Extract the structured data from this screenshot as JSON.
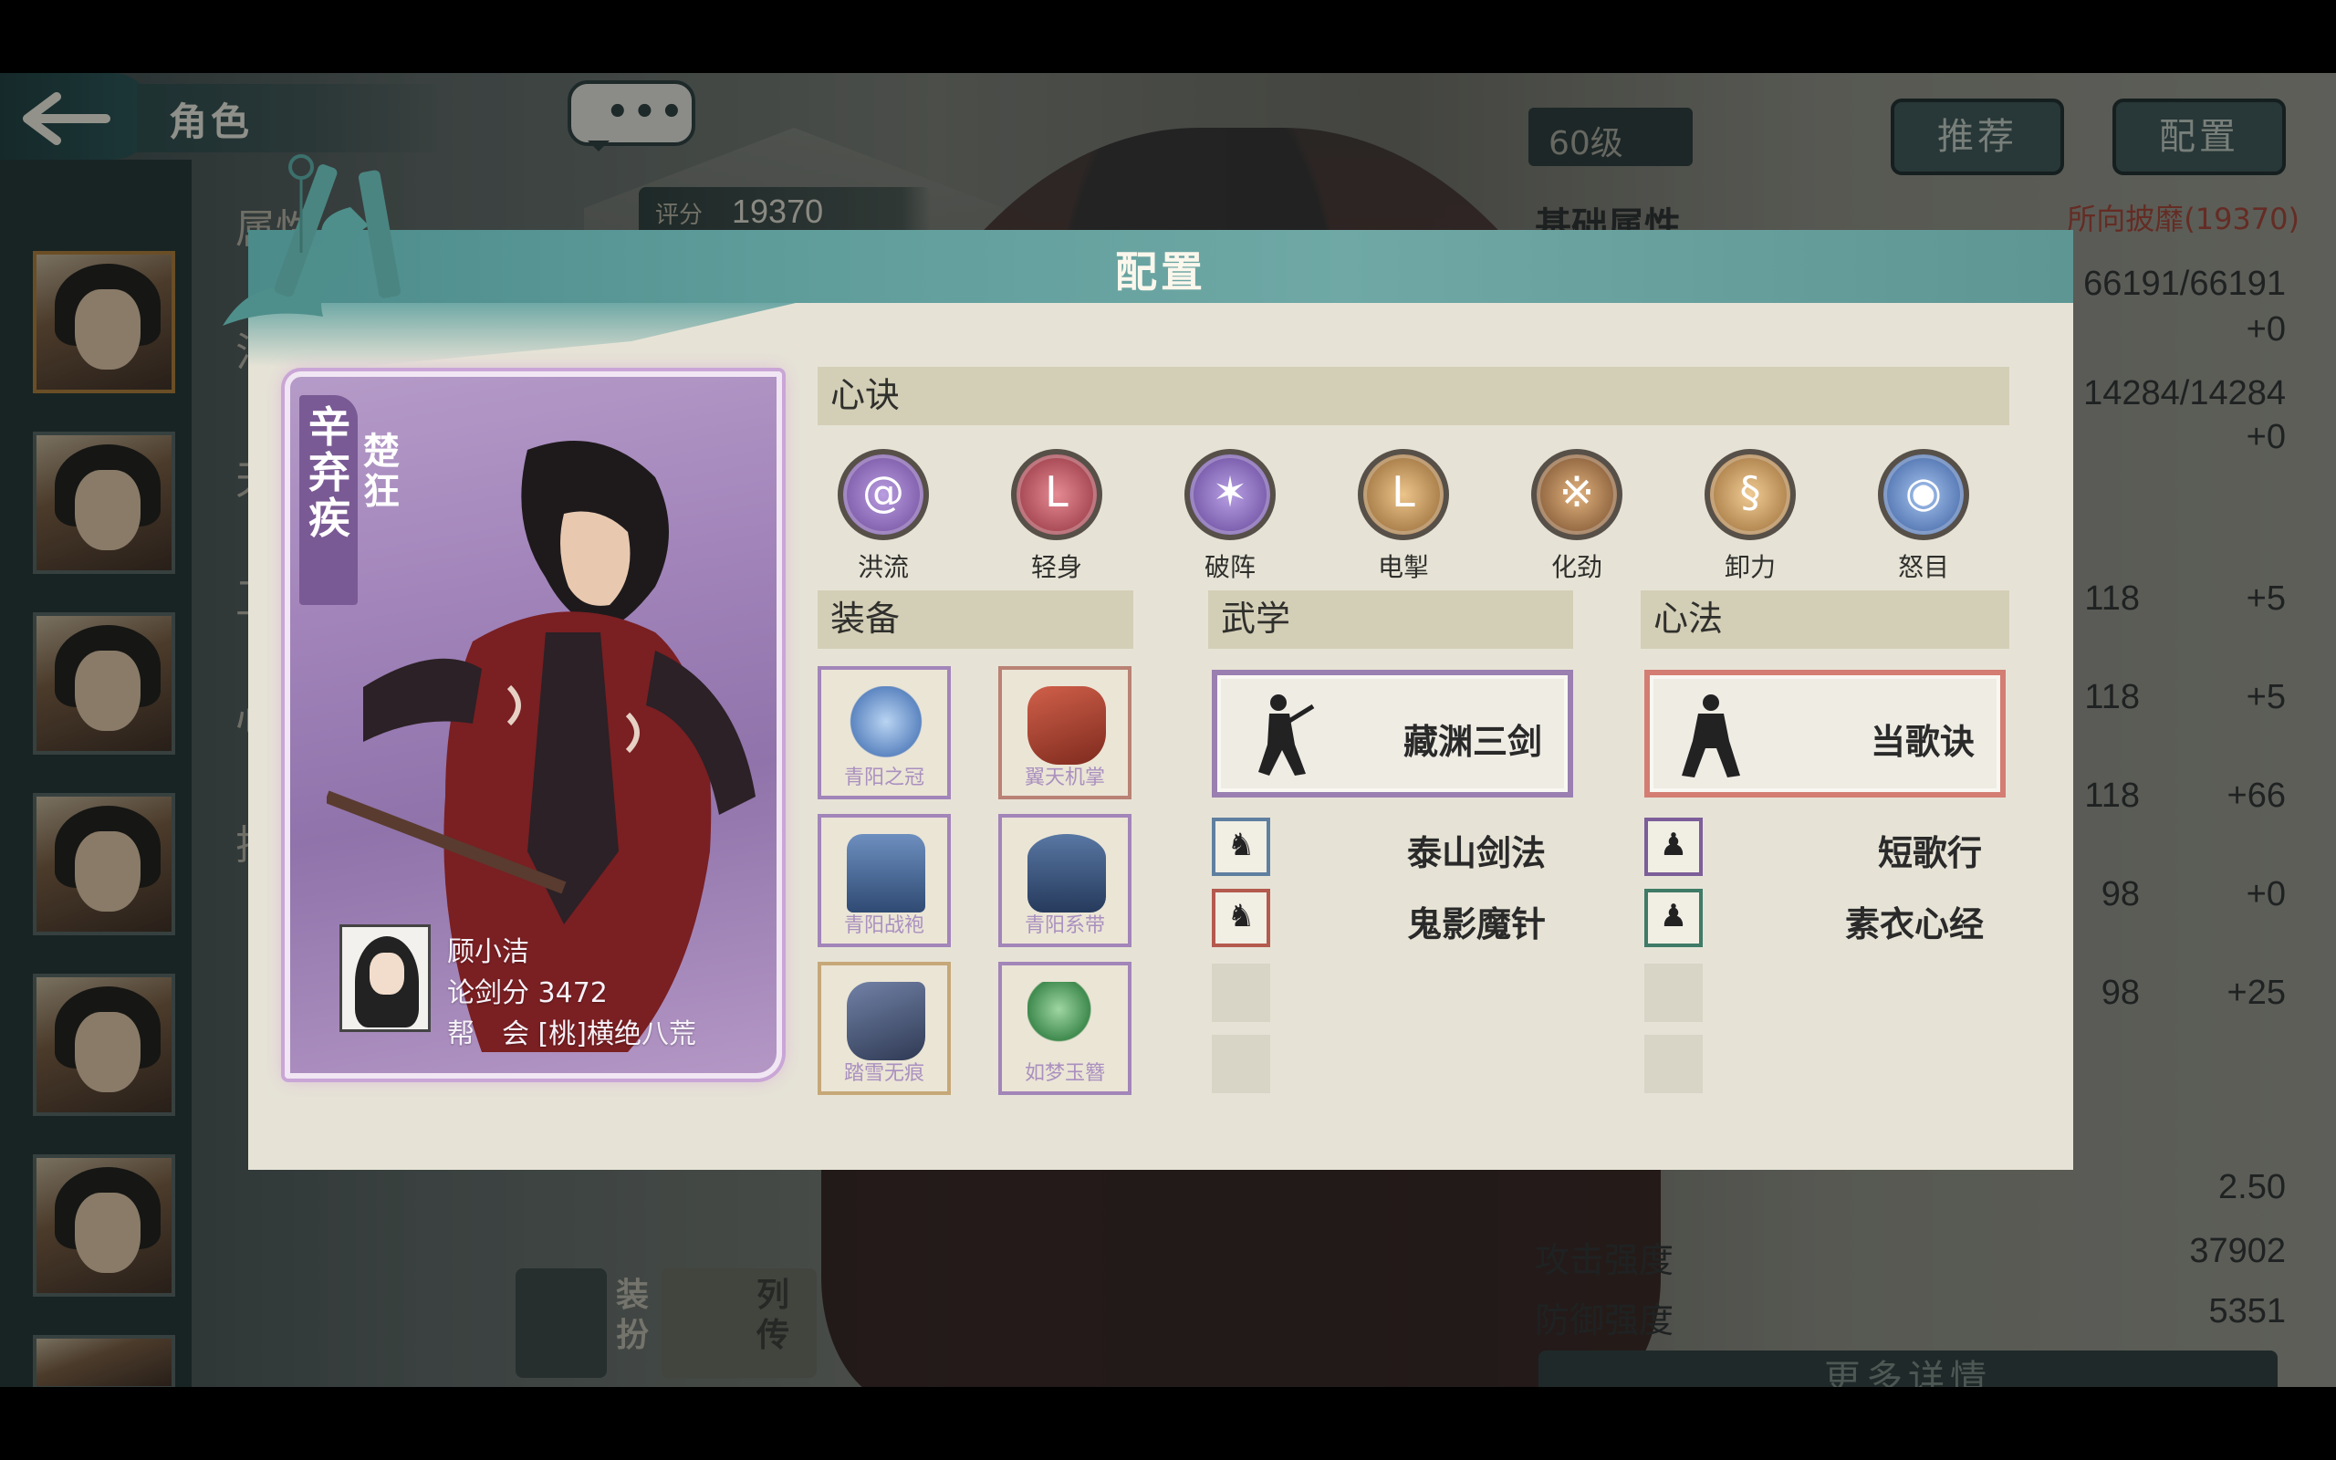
{
  "header": {
    "back_icon": "arrow-left-icon",
    "title": "角色",
    "chat_icon": "ellipsis-chat-icon",
    "chat_text": "•••",
    "score_label": "评分",
    "score_value": "19370",
    "level": "60级",
    "recommend_label": "推荐",
    "config_label": "配置"
  },
  "side_labels": [
    "属性",
    "法",
    "天",
    "卫",
    "心",
    "技"
  ],
  "attributes": {
    "title": "基础属性",
    "badge": "所向披靡(19370)",
    "rows": [
      {
        "v1": "66191/66191",
        "v2": ""
      },
      {
        "v1": "",
        "v2": "+0"
      },
      {
        "v1": "14284/14284",
        "v2": ""
      },
      {
        "v1": "",
        "v2": "+0"
      },
      {
        "v1": "118",
        "v2": "+5"
      },
      {
        "v1": "118",
        "v2": "+5"
      },
      {
        "v1": "118",
        "v2": "+66"
      },
      {
        "v1": "98",
        "v2": "+0"
      },
      {
        "v1": "98",
        "v2": "+25"
      }
    ],
    "crit_value": "2.50",
    "attack_label": "攻击强度",
    "attack_value": "37902",
    "defense_label": "防御强度",
    "defense_value": "5351",
    "more_label": "更多详情"
  },
  "bottom_tabs": [
    {
      "label": "装扮",
      "icon": "outfit-icon"
    },
    {
      "label": "列传",
      "icon": "biography-icon"
    }
  ],
  "modal": {
    "title": "配置",
    "card": {
      "name": "辛弃疾",
      "epithet": "楚狂",
      "owner_name": "顾小洁",
      "owner_score_line": "论剑分 3472",
      "owner_guild_line": "帮　会 [桃]横绝八荒"
    },
    "xinjue": {
      "header": "心诀",
      "skills": [
        {
          "label": "洪流",
          "icon": "swirl-icon",
          "color": "#8a64b4"
        },
        {
          "label": "轻身",
          "icon": "l-rune-icon",
          "color": "#b44a55"
        },
        {
          "label": "破阵",
          "icon": "shatter-icon",
          "color": "#8a6ab8"
        },
        {
          "label": "电掣",
          "icon": "l-rune-icon",
          "color": "#b8894e"
        },
        {
          "label": "化劲",
          "icon": "crack-icon",
          "color": "#b17a44"
        },
        {
          "label": "卸力",
          "icon": "swirl-icon",
          "color": "#c19151"
        },
        {
          "label": "怒目",
          "icon": "eye-icon",
          "color": "#4f73b3"
        }
      ]
    },
    "equipment": {
      "header": "装备",
      "items": [
        {
          "name": "青阳之冠",
          "icon": "crown-icon",
          "color": "#6f95c7"
        },
        {
          "name": "翼天机掌",
          "icon": "gauntlet-icon",
          "color": "#a64431"
        },
        {
          "name": "青阳战袍",
          "icon": "robe-icon",
          "color": "#4f6d9a"
        },
        {
          "name": "青阳系带",
          "icon": "belt-icon",
          "color": "#3f5e86"
        },
        {
          "name": "踏雪无痕",
          "icon": "boots-icon",
          "color": "#4c5a7a"
        },
        {
          "name": "如梦玉簪",
          "icon": "hairpin-icon",
          "color": "#5ea266"
        }
      ]
    },
    "wuxue": {
      "header": "武学",
      "main": "藏渊三剑",
      "main_icon": "swordsman-icon",
      "items": [
        {
          "name": "泰山剑法",
          "icon": "sword-pose-icon"
        },
        {
          "name": "鬼影魔针",
          "icon": "needle-pose-icon"
        }
      ]
    },
    "xinfa": {
      "header": "心法",
      "main": "当歌诀",
      "main_icon": "stance-icon",
      "items": [
        {
          "name": "短歌行",
          "icon": "meditate-icon"
        },
        {
          "name": "素衣心经",
          "icon": "meditate-icon"
        }
      ]
    }
  }
}
